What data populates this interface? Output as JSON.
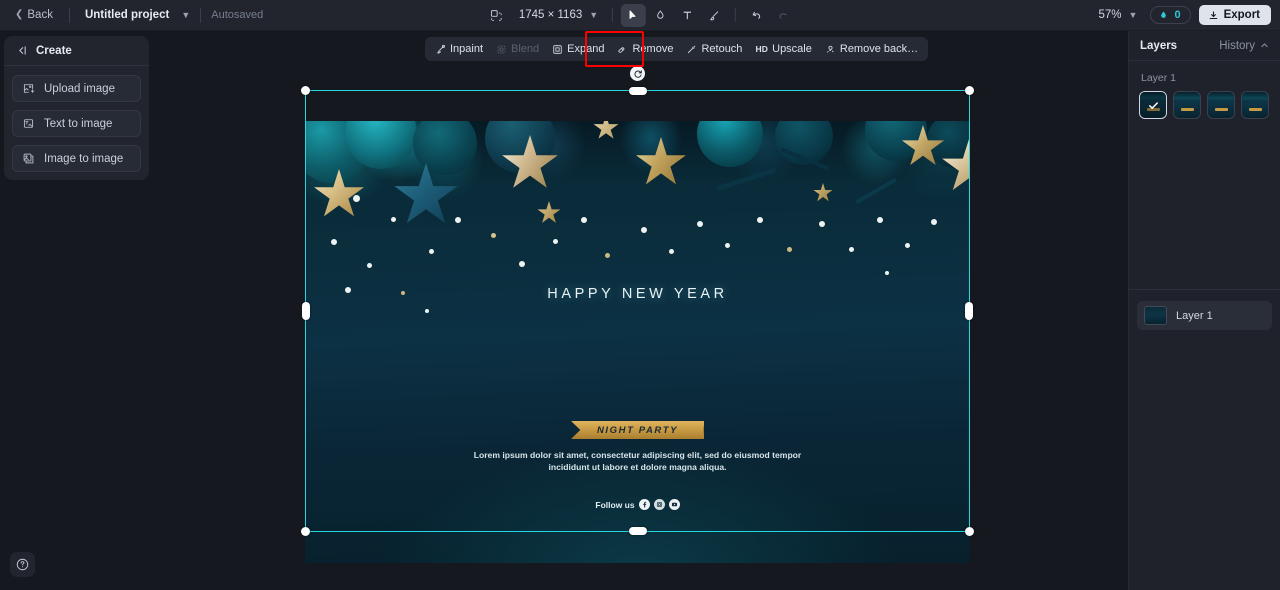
{
  "topbar": {
    "back_label": "Back",
    "project_name": "Untitled project",
    "autosaved_label": "Autosaved",
    "canvas_size": "1745 × 1163",
    "zoom_level": "57%",
    "credits_count": "0",
    "export_label": "Export",
    "tools": [
      {
        "name": "resize-canvas-icon",
        "title": "Resize canvas"
      },
      {
        "name": "select-tool",
        "title": "Select",
        "active": true
      },
      {
        "name": "eyedropper-tool",
        "title": "Color picker"
      },
      {
        "name": "text-tool",
        "title": "Text"
      },
      {
        "name": "brush-tool",
        "title": "Brush"
      },
      {
        "name": "undo-button",
        "title": "Undo"
      },
      {
        "name": "redo-button",
        "title": "Redo"
      }
    ]
  },
  "sidebar": {
    "title": "Create",
    "items": [
      {
        "label": "Upload image",
        "icon": "upload-image-icon"
      },
      {
        "label": "Text to image",
        "icon": "text-to-image-icon"
      },
      {
        "label": "Image to image",
        "icon": "image-to-image-icon"
      }
    ]
  },
  "action_toolbar": {
    "items": [
      {
        "label": "Inpaint",
        "icon": "inpaint-icon",
        "disabled": false
      },
      {
        "label": "Blend",
        "icon": "blend-icon",
        "disabled": true
      },
      {
        "label": "Expand",
        "icon": "expand-icon",
        "disabled": false
      },
      {
        "label": "Remove",
        "icon": "remove-icon",
        "disabled": false,
        "highlighted": true
      },
      {
        "label": "Retouch",
        "icon": "retouch-icon",
        "disabled": false
      },
      {
        "label": "Upscale",
        "icon": "hd-icon",
        "disabled": false
      },
      {
        "label": "Remove back…",
        "icon": "remove-background-icon",
        "disabled": false
      }
    ],
    "highlight_color": "#ff0000"
  },
  "artwork": {
    "title": "HAPPY NEW YEAR",
    "ribbon_text": "NIGHT PARTY",
    "body_text": "Lorem ipsum dolor sit amet, consectetur adipiscing elit, sed do eiusmod tempor incididunt ut labore et dolore magna aliqua.",
    "follow_label": "Follow us",
    "social_icons": [
      "facebook-icon",
      "instagram-icon",
      "youtube-icon"
    ]
  },
  "right_panel": {
    "layers_tab": "Layers",
    "history_tab": "History",
    "group_label": "Layer 1",
    "thumbnails": [
      {
        "name": "version-thumbnail-1",
        "selected": true
      },
      {
        "name": "version-thumbnail-2",
        "selected": false
      },
      {
        "name": "version-thumbnail-3",
        "selected": false
      },
      {
        "name": "version-thumbnail-4",
        "selected": false
      }
    ],
    "layers": [
      {
        "name": "Layer 1"
      }
    ]
  },
  "colors": {
    "accent": "#25d7e0",
    "credits": "#2ec5d8",
    "highlight": "#ff0000",
    "panel_bg": "#22252e",
    "canvas_bg": "#16181f"
  }
}
